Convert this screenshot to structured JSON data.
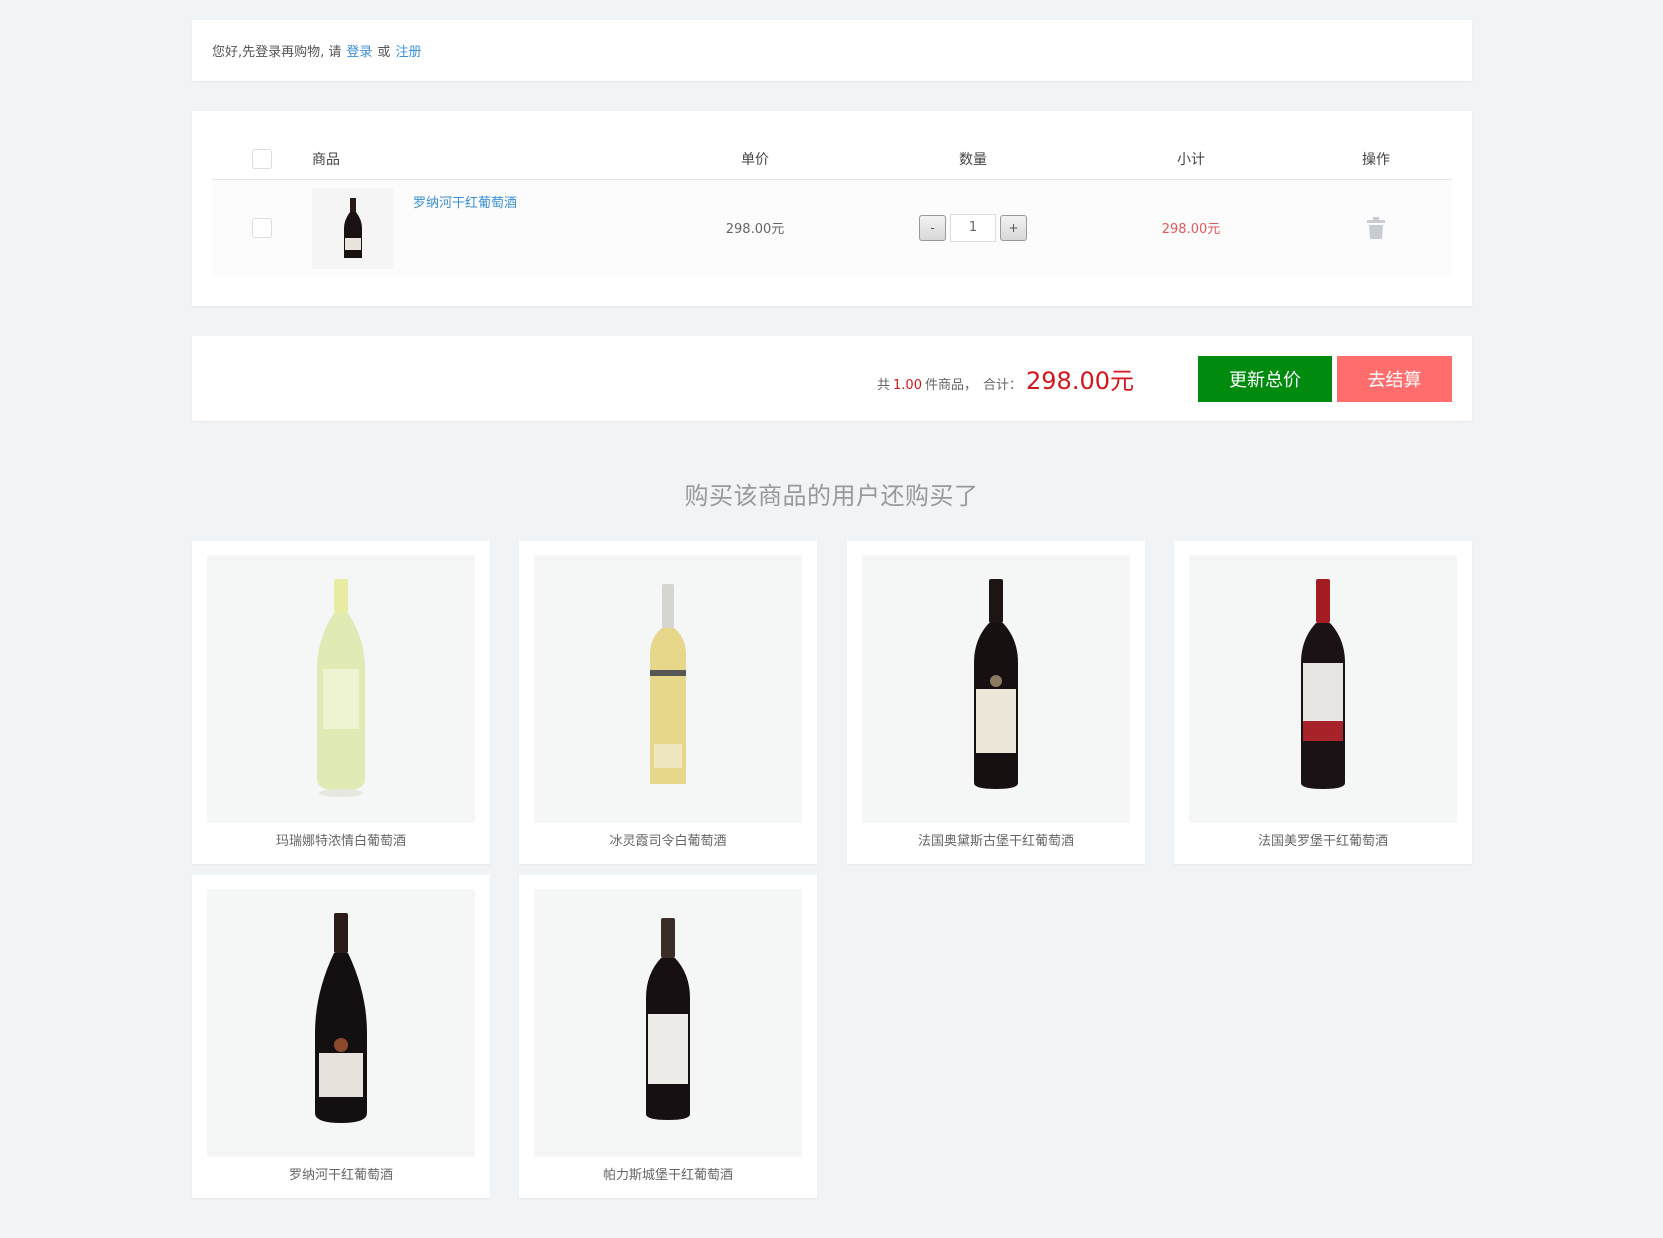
{
  "login_bar": {
    "prefix": "您好,先登录再购物, 请",
    "login_label": "登录",
    "or": "或",
    "register_label": "注册"
  },
  "cart": {
    "headers": {
      "product": "商品",
      "unit_price": "单价",
      "quantity": "数量",
      "subtotal": "小计",
      "action": "操作"
    },
    "items": [
      {
        "name": "罗纳河干红葡萄酒",
        "price": "298.00元",
        "quantity": "1",
        "subtotal": "298.00元",
        "minus_label": "-",
        "plus_label": "+"
      }
    ]
  },
  "summary": {
    "count_prefix": "共",
    "count": "1.00",
    "count_suffix": "件商品，",
    "total_label": "合计：",
    "total": "298.00元",
    "update_label": "更新总价",
    "checkout_label": "去结算"
  },
  "recommendations": {
    "title": "购买该商品的用户还购买了",
    "products": [
      {
        "name": "玛瑞娜特浓情白葡萄酒"
      },
      {
        "name": "冰灵霞司令白葡萄酒"
      },
      {
        "name": "法国奥黛斯古堡干红葡萄酒"
      },
      {
        "name": "法国美罗堡干红葡萄酒"
      },
      {
        "name": "罗纳河干红葡萄酒"
      },
      {
        "name": "帕力斯城堡干红葡萄酒"
      }
    ]
  },
  "colors": {
    "link": "#3a8fd6",
    "price_red": "#d4161c",
    "update_green": "#008a0e",
    "checkout_pink": "#ff6d6d"
  }
}
